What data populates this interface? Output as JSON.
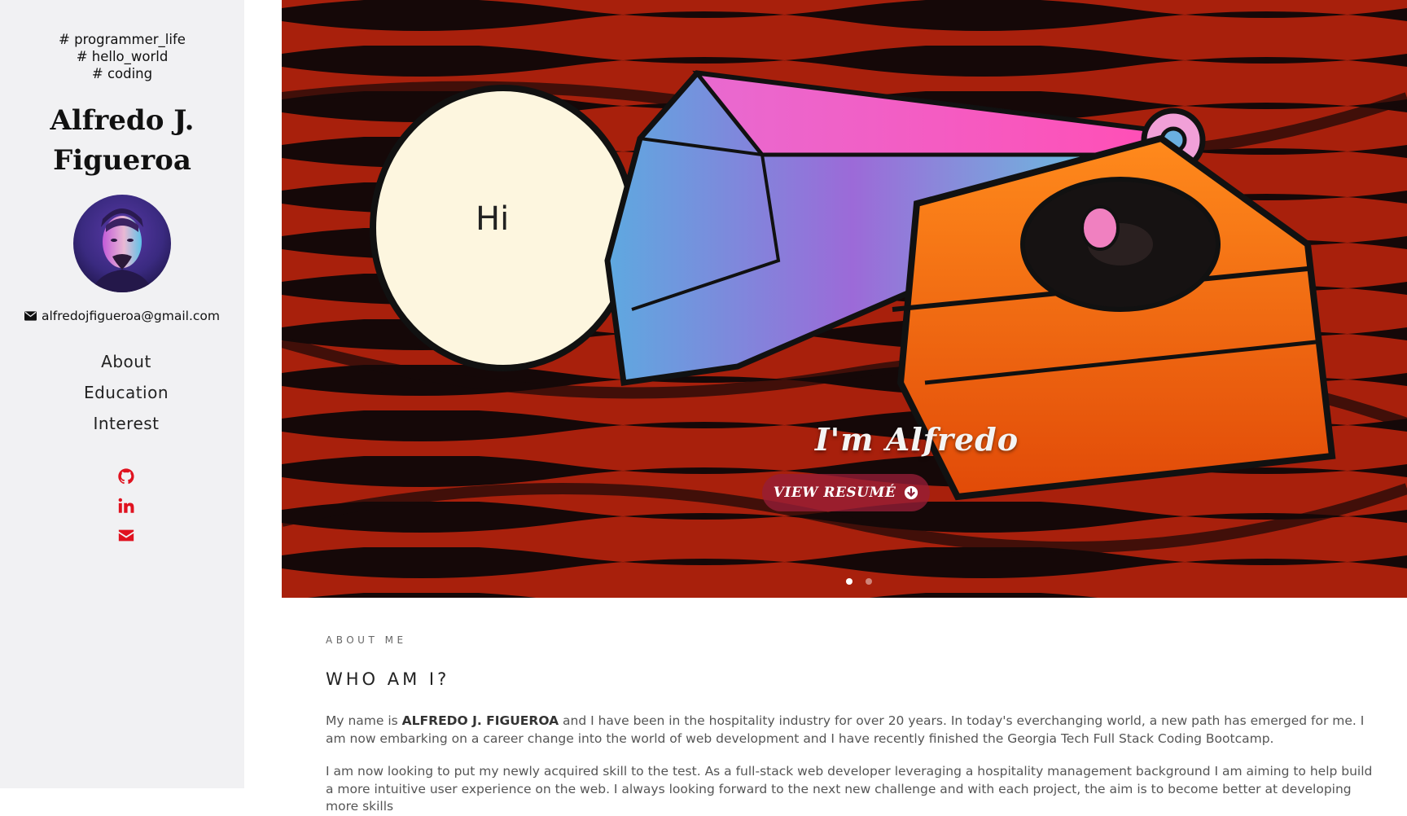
{
  "sidebar": {
    "tags": [
      "# programmer_life",
      "# hello_world",
      "# coding"
    ],
    "name_line1": "Alfredo J.",
    "name_line2": "Figueroa",
    "email": "alfredojfigueroa@gmail.com",
    "nav": [
      "About",
      "Education",
      "Interest"
    ],
    "social_icons": [
      "github-icon",
      "linkedin-icon",
      "envelope-icon"
    ],
    "accent_color": "#e0121f"
  },
  "hero": {
    "speech_bubble": "Hi",
    "title": "I'm Alfredo",
    "button_label": "VIEW RESUMÉ",
    "slides": 2,
    "active_slide": 1
  },
  "about": {
    "kicker": "ABOUT ME",
    "heading": "WHO AM I?",
    "p1_prefix": "My name is ",
    "p1_name": "ALFREDO J. FIGUEROA",
    "p1_rest": " and I have been in the hospitality industry for over 20 years. In today's everchanging world, a new path has emerged for me. I am now embarking on a career change into the world of web development and I have recently finished the Georgia Tech Full Stack Coding Bootcamp.",
    "p2": "I am now looking to put my newly acquired skill to the test. As a full-stack web developer leveraging a hospitality management background I am aiming to help build a more intuitive user experience on the web. I always looking forward to the next new challenge and with each project, the aim is to become better at developing more skills"
  }
}
